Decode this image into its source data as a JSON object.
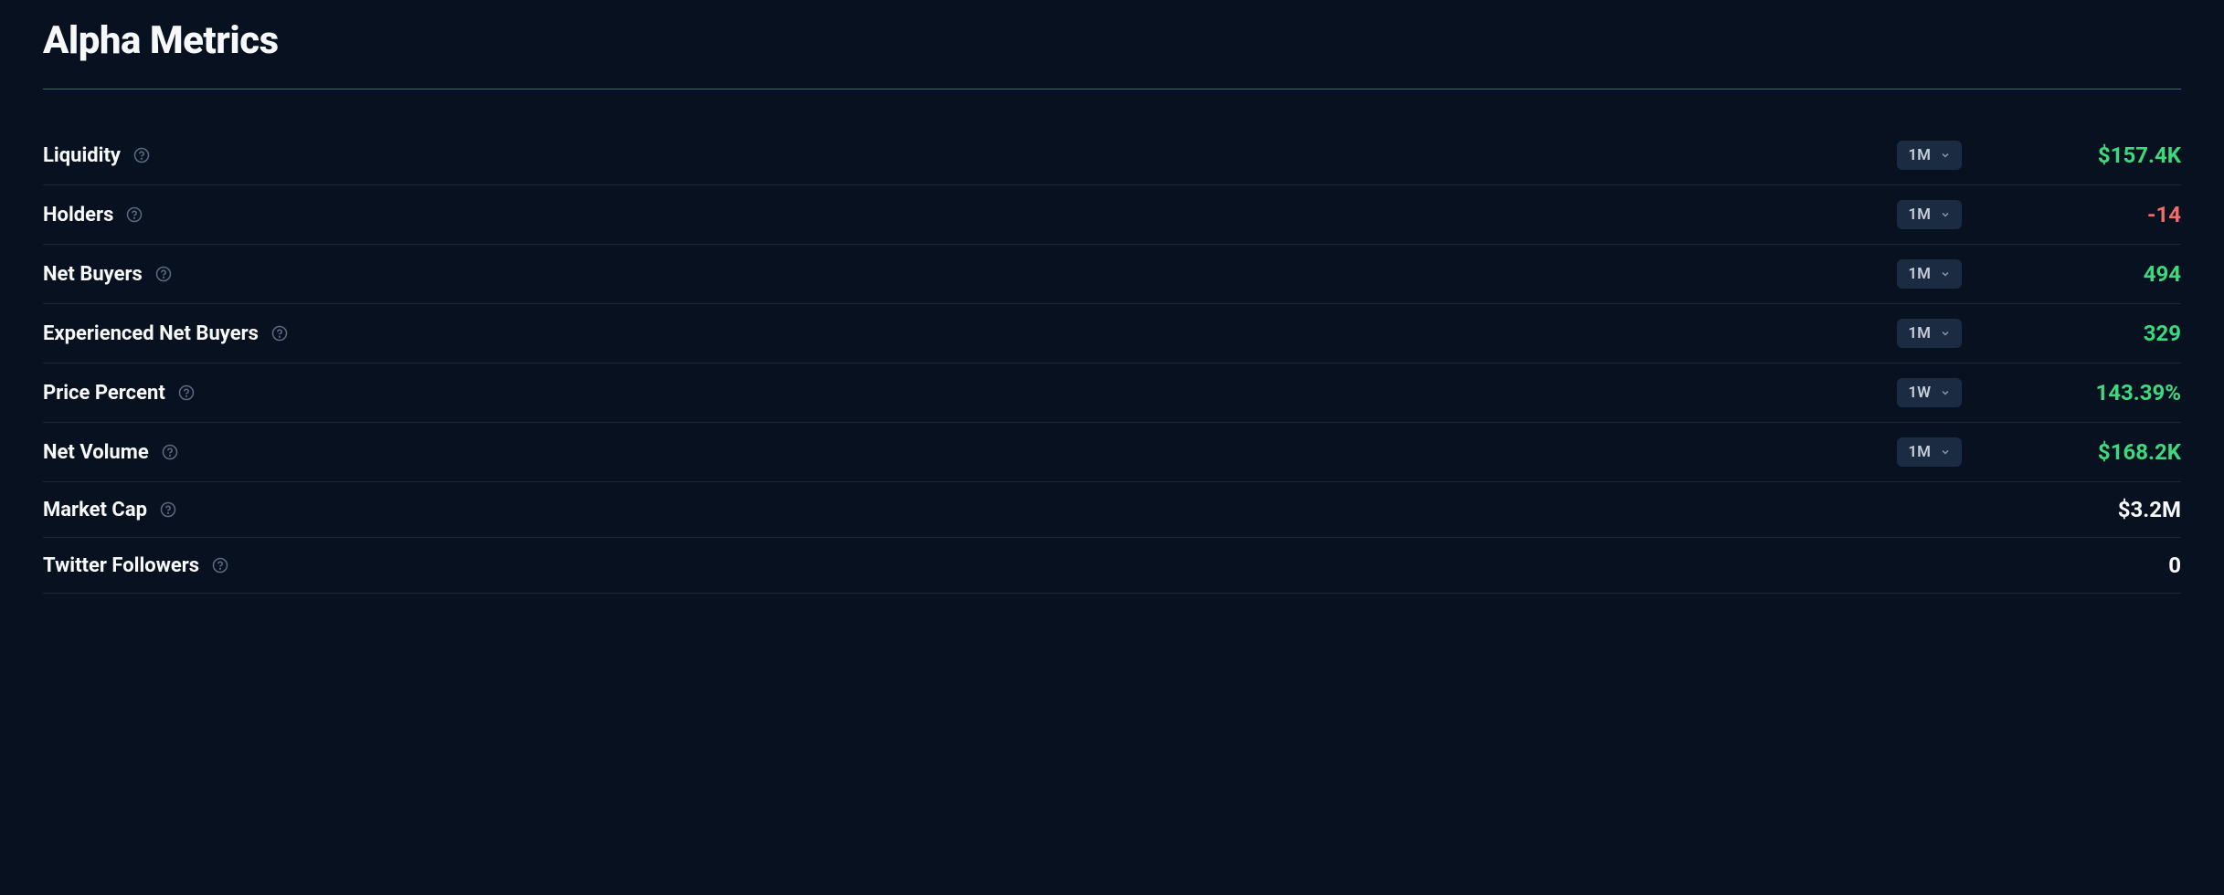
{
  "section": {
    "title": "Alpha Metrics"
  },
  "metrics": [
    {
      "label": "Liquidity",
      "dropdown": "1M",
      "value": "$157.4K",
      "color": "green",
      "hasDropdown": true
    },
    {
      "label": "Holders",
      "dropdown": "1M",
      "value": "-14",
      "color": "red",
      "hasDropdown": true
    },
    {
      "label": "Net Buyers",
      "dropdown": "1M",
      "value": "494",
      "color": "green",
      "hasDropdown": true
    },
    {
      "label": "Experienced Net Buyers",
      "dropdown": "1M",
      "value": "329",
      "color": "green",
      "hasDropdown": true
    },
    {
      "label": "Price Percent",
      "dropdown": "1W",
      "value": "143.39%",
      "color": "green",
      "hasDropdown": true
    },
    {
      "label": "Net Volume",
      "dropdown": "1M",
      "value": "$168.2K",
      "color": "green",
      "hasDropdown": true
    },
    {
      "label": "Market Cap",
      "value": "$3.2M",
      "color": "white",
      "hasDropdown": false
    },
    {
      "label": "Twitter Followers",
      "value": "0",
      "color": "white",
      "hasDropdown": false
    }
  ]
}
